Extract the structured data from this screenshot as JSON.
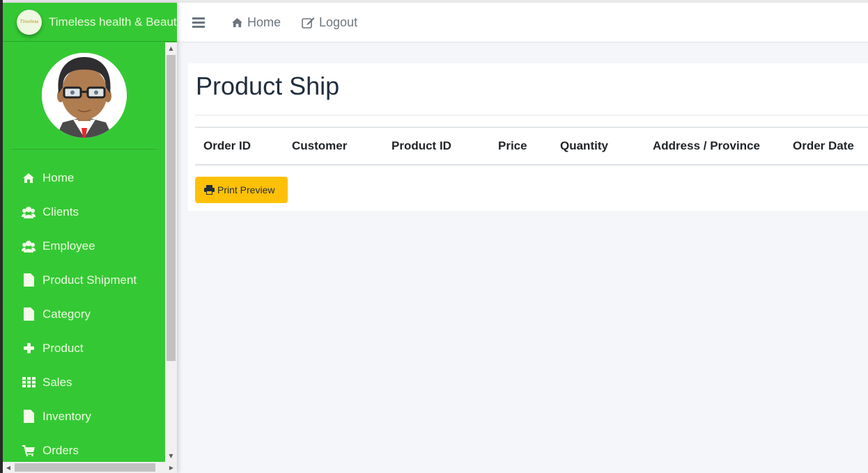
{
  "brand": {
    "name": "Timeless health & Beauty",
    "logo_icon": "brand-logo-icon",
    "logo_text": "Timeless"
  },
  "navbar": {
    "menu_toggle_icon": "bars-icon",
    "links": [
      {
        "label": "Home",
        "icon": "home-icon"
      },
      {
        "label": "Logout",
        "icon": "edit-icon"
      }
    ]
  },
  "user": {
    "avatar": "user-avatar"
  },
  "sidebar": {
    "items": [
      {
        "label": "Home",
        "icon": "home-icon"
      },
      {
        "label": "Clients",
        "icon": "users-icon"
      },
      {
        "label": "Employee",
        "icon": "users-icon"
      },
      {
        "label": "Product Shipment",
        "icon": "file-icon"
      },
      {
        "label": "Category",
        "icon": "file-icon"
      },
      {
        "label": "Product",
        "icon": "plus-icon"
      },
      {
        "label": "Sales",
        "icon": "th-icon"
      },
      {
        "label": "Inventory",
        "icon": "file-icon"
      },
      {
        "label": "Orders",
        "icon": "shopping-cart-icon"
      }
    ]
  },
  "main": {
    "title": "Product Ship",
    "table": {
      "columns": [
        "Order ID",
        "Customer",
        "Product ID",
        "Price",
        "Quantity",
        "Address / Province",
        "Order Date"
      ],
      "rows": []
    },
    "print_button": {
      "label": "Print Preview",
      "icon": "print-icon"
    }
  },
  "colors": {
    "sidebar": "#34c934",
    "print_button": "#ffc107",
    "background": "#f4f6f9"
  }
}
